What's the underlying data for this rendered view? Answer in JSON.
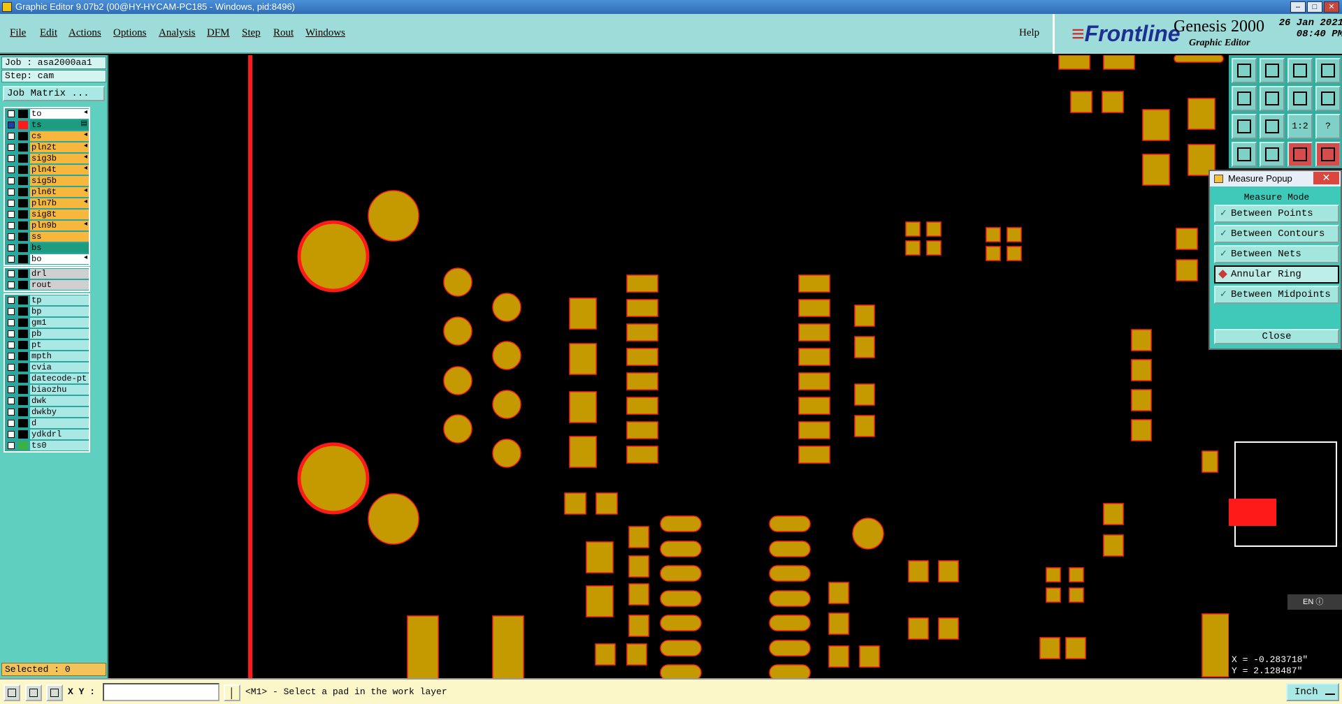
{
  "window": {
    "title": "Graphic Editor 9.07b2 (00@HY-HYCAM-PC185 - Windows, pid:8496)",
    "buttons": [
      "–",
      "□",
      "✕"
    ]
  },
  "menu": {
    "items": [
      "File",
      "Edit",
      "Actions",
      "Options",
      "Analysis",
      "DFM",
      "Step",
      "Rout",
      "Windows"
    ],
    "help": "Help"
  },
  "logo": {
    "brand": "Frontline",
    "product": "Genesis 2000",
    "subtitle": "Graphic Editor",
    "date": "26 Jan 2021",
    "time": "08:40 PM"
  },
  "left_panel": {
    "job": "Job : asa2000aa1",
    "step": "Step: cam",
    "job_matrix": "Job Matrix ...",
    "selected": "Selected : 0",
    "layer_groups": [
      {
        "layers": [
          {
            "name": "to",
            "bg": "#ffffff",
            "swatch": "#000000",
            "arrow": "◂"
          },
          {
            "name": "ts",
            "bg": "#1e9c82",
            "swatch": "#ff1a1a",
            "arrow": "▤",
            "checked": true
          },
          {
            "name": "cs",
            "bg": "#f6b73c",
            "swatch": "#000000",
            "arrow": "◂"
          },
          {
            "name": "pln2t",
            "bg": "#f6b73c",
            "swatch": "#000000",
            "arrow": "◂"
          },
          {
            "name": "sig3b",
            "bg": "#f6b73c",
            "swatch": "#000000",
            "arrow": "◂"
          },
          {
            "name": "pln4t",
            "bg": "#f6b73c",
            "swatch": "#000000",
            "arrow": "◂"
          },
          {
            "name": "sig5b",
            "bg": "#f6b73c",
            "swatch": "#000000",
            "arrow": ""
          },
          {
            "name": "pln6t",
            "bg": "#f6b73c",
            "swatch": "#000000",
            "arrow": "◂"
          },
          {
            "name": "pln7b",
            "bg": "#f6b73c",
            "swatch": "#000000",
            "arrow": "◂"
          },
          {
            "name": "sig8t",
            "bg": "#f6b73c",
            "swatch": "#000000",
            "arrow": ""
          },
          {
            "name": "pln9b",
            "bg": "#f6b73c",
            "swatch": "#000000",
            "arrow": "◂"
          },
          {
            "name": "ss",
            "bg": "#f6b73c",
            "swatch": "#000000",
            "arrow": ""
          },
          {
            "name": "bs",
            "bg": "#1e9c82",
            "swatch": "#000000",
            "arrow": ""
          },
          {
            "name": "bo",
            "bg": "#ffffff",
            "swatch": "#000000",
            "arrow": "◂"
          }
        ]
      },
      {
        "layers": [
          {
            "name": "drl",
            "bg": "#cfcfcf",
            "swatch": "#000000",
            "arrow": ""
          },
          {
            "name": "rout",
            "bg": "#cfcfcf",
            "swatch": "#000000",
            "arrow": ""
          }
        ]
      },
      {
        "layers": [
          {
            "name": "tp",
            "bg": "#a9e8e4",
            "swatch": "#000000",
            "arrow": ""
          },
          {
            "name": "bp",
            "bg": "#a9e8e4",
            "swatch": "#000000",
            "arrow": ""
          },
          {
            "name": "gm1",
            "bg": "#a9e8e4",
            "swatch": "#000000",
            "arrow": ""
          },
          {
            "name": "pb",
            "bg": "#a9e8e4",
            "swatch": "#000000",
            "arrow": ""
          },
          {
            "name": "pt",
            "bg": "#a9e8e4",
            "swatch": "#000000",
            "arrow": ""
          },
          {
            "name": "mpth",
            "bg": "#a9e8e4",
            "swatch": "#000000",
            "arrow": ""
          },
          {
            "name": "cvia",
            "bg": "#a9e8e4",
            "swatch": "#000000",
            "arrow": ""
          },
          {
            "name": "datecode-pt",
            "bg": "#a9e8e4",
            "swatch": "#000000",
            "arrow": ""
          },
          {
            "name": "biaozhu",
            "bg": "#a9e8e4",
            "swatch": "#000000",
            "arrow": ""
          },
          {
            "name": "dwk",
            "bg": "#a9e8e4",
            "swatch": "#000000",
            "arrow": ""
          },
          {
            "name": "dwkby",
            "bg": "#a9e8e4",
            "swatch": "#000000",
            "arrow": ""
          },
          {
            "name": "d",
            "bg": "#a9e8e4",
            "swatch": "#000000",
            "arrow": ""
          },
          {
            "name": "ydkdrl",
            "bg": "#a9e8e4",
            "swatch": "#000000",
            "arrow": ""
          },
          {
            "name": "ts0",
            "bg": "#a9e8e4",
            "swatch": "#3cb043",
            "arrow": ""
          }
        ]
      }
    ]
  },
  "toolbox": {
    "buttons": [
      {
        "icon": "upload-icon",
        "text": ""
      },
      {
        "icon": "download-icon",
        "text": ""
      },
      {
        "icon": "home-icon",
        "text": ""
      },
      {
        "icon": "split-view-icon",
        "text": ""
      },
      {
        "icon": "pan-left-icon",
        "text": ""
      },
      {
        "icon": "pan-right-icon",
        "text": ""
      },
      {
        "icon": "mirror-icon",
        "text": ""
      },
      {
        "icon": "snake-icon",
        "text": ""
      },
      {
        "icon": "fit-screen-icon",
        "text": ""
      },
      {
        "icon": "zoom-fit-icon",
        "text": ""
      },
      {
        "icon": "scale-icon",
        "text": "1:2"
      },
      {
        "icon": "help-icon",
        "text": "?"
      },
      {
        "icon": "camera-icon",
        "text": ""
      },
      {
        "icon": "grid-icon",
        "text": ""
      },
      {
        "icon": "layers-icon",
        "text": "",
        "red": true
      },
      {
        "icon": "sliders-icon",
        "text": "",
        "red": true
      }
    ]
  },
  "measure_popup": {
    "title": "Measure Popup",
    "mode_label": "Measure Mode",
    "options": [
      {
        "label": "Between Points",
        "selected": false
      },
      {
        "label": "Between Contours",
        "selected": false
      },
      {
        "label": "Between Nets",
        "selected": false
      },
      {
        "label": "Annular Ring",
        "selected": true
      },
      {
        "label": "Between Midpoints",
        "selected": false
      }
    ],
    "close": "Close"
  },
  "ime": "EN",
  "coords": {
    "x": "X = -0.283718\"",
    "y": "Y = 2.128487\""
  },
  "bottom": {
    "xy_label": "X Y :",
    "xy_value": "",
    "prompt": "<M1> - Select a pad in the work layer",
    "units": "Inch"
  },
  "colors": {
    "pad_fill": "#c49a00",
    "pad_outline": "#ff2020",
    "highlight": "#ff1a1a",
    "panel_teal": "#5fd0c0",
    "menu_bg": "#9ddcd9"
  }
}
